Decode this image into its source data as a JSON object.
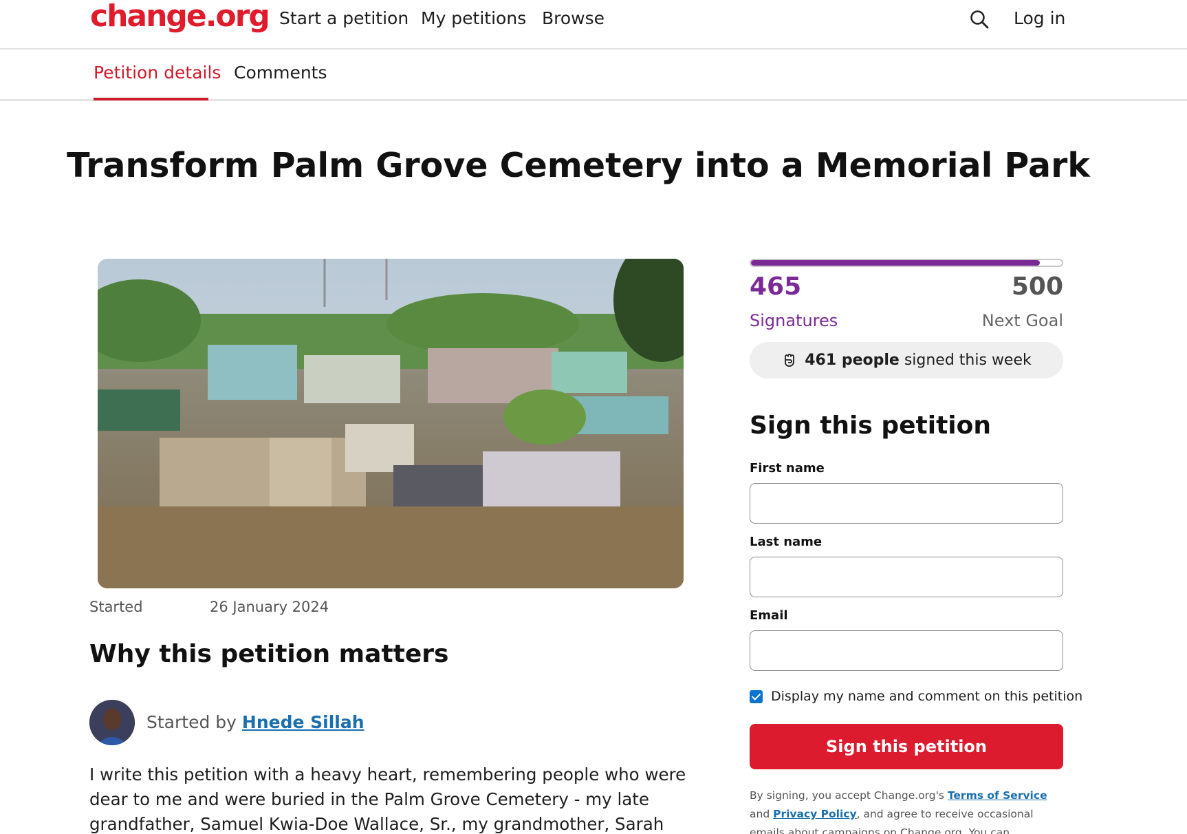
{
  "nav": {
    "logo": "change.org",
    "links": [
      "Start a petition",
      "My petitions",
      "Browse"
    ],
    "login": "Log in",
    "search_icon": "search-icon"
  },
  "tabs": [
    "Petition details",
    "Comments"
  ],
  "petition": {
    "title": "Transform Palm Grove Cemetery into a Memorial Park",
    "started_label": "Started",
    "started_date": "26 January 2024",
    "why_heading": "Why this petition matters",
    "started_by_prefix": "Started by",
    "author": "Hnede Sillah",
    "body": "I write this petition with a heavy heart, remembering people who were dear to me and were buried in the Palm Grove Cemetery - my late grandfather, Samuel Kwia-Doe Wallace, Sr., my grandmother, Sarah Hnede Wallace, and my"
  },
  "signatures": {
    "count": "465",
    "goal": "500",
    "progress_fraction": 0.93,
    "count_label": "Signatures",
    "goal_label": "Next Goal",
    "week_count": "461 people",
    "week_suffix": "signed this week",
    "accent_color": "#7a2a96"
  },
  "form": {
    "heading": "Sign this petition",
    "first_name_label": "First name",
    "last_name_label": "Last name",
    "email_label": "Email",
    "display_checkbox_label": "Display my name and comment on this petition",
    "display_checked": true,
    "submit_label": "Sign this petition",
    "button_color": "#dc1c2e"
  },
  "legal": {
    "prefix": "By signing, you accept Change.org's",
    "terms": "Terms of Service",
    "and": "and",
    "privacy": "Privacy Policy",
    "suffix": ", and agree to receive occasional emails about campaigns on Change.org. You can unsubscribe at any time."
  }
}
